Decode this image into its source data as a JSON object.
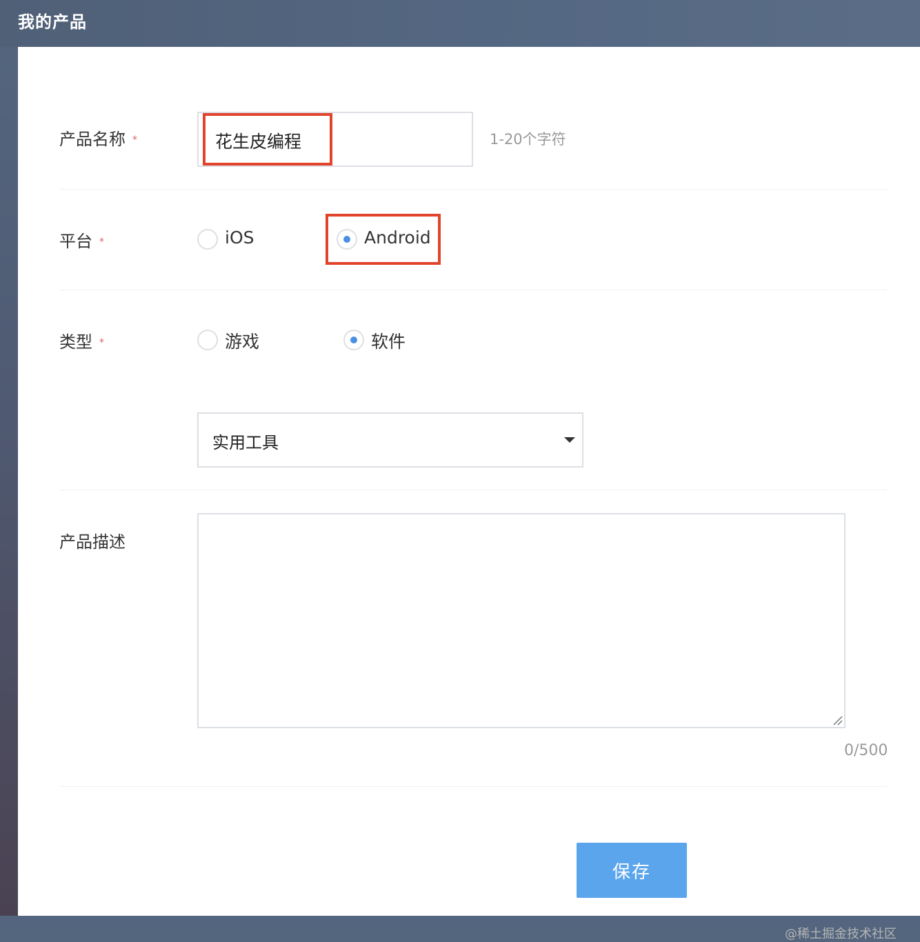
{
  "header": {
    "title": "我的产品"
  },
  "form": {
    "name_field": {
      "label": "产品名称",
      "required_mark": "*",
      "value": "花生皮编程",
      "hint": "1-20个字符"
    },
    "platform_field": {
      "label": "平台",
      "required_mark": "*",
      "options": [
        {
          "label": "iOS",
          "selected": false
        },
        {
          "label": "Android",
          "selected": true
        }
      ]
    },
    "type_field": {
      "label": "类型",
      "required_mark": "*",
      "options": [
        {
          "label": "游戏",
          "selected": false
        },
        {
          "label": "软件",
          "selected": true
        }
      ],
      "category_select": {
        "value": "实用工具"
      }
    },
    "description_field": {
      "label": "产品描述",
      "value": "",
      "counter": "0/500"
    },
    "save_label": "保存"
  },
  "watermark": "@稀土掘金技术社区",
  "colors": {
    "accent": "#4a90e2",
    "button": "#5ba5ed",
    "highlight": "#e2432b",
    "required": "#e06060"
  }
}
